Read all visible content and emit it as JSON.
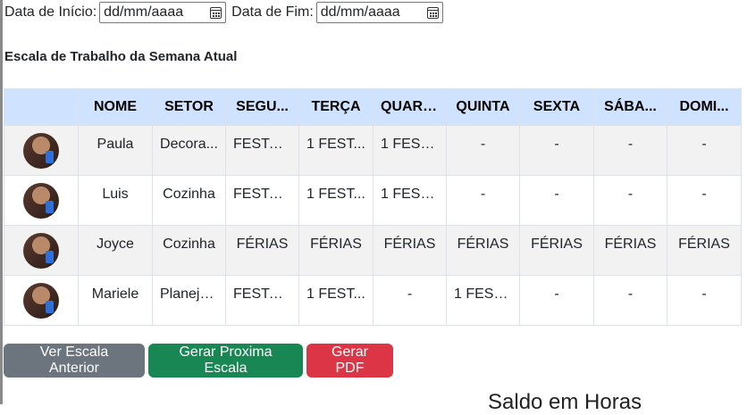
{
  "filters": {
    "start_label": "Data de Início:",
    "start_value": "dd/mm/aaaa",
    "end_label": "Data de Fim:",
    "end_value": "dd/mm/aaaa"
  },
  "title": "Escala de Trabalho da Semana Atual",
  "table": {
    "headers": [
      "",
      "NOME",
      "SETOR",
      "SEGU...",
      "TERÇA",
      "QUARTA",
      "QUINTA",
      "SEXTA",
      "SÁBA...",
      "DOMI..."
    ],
    "rows": [
      {
        "name": "Paula",
        "sector": "Decora...",
        "days": [
          "FESTAS...",
          "1 FEST...",
          "1 FEST...",
          "-",
          "-",
          "-",
          "-"
        ]
      },
      {
        "name": "Luis",
        "sector": "Cozinha",
        "days": [
          "FESTAS...",
          "1 FEST...",
          "1 FEST...",
          "-",
          "-",
          "-",
          "-"
        ]
      },
      {
        "name": "Joyce",
        "sector": "Cozinha",
        "days": [
          "FÉRIAS",
          "FÉRIAS",
          "FÉRIAS",
          "FÉRIAS",
          "FÉRIAS",
          "FÉRIAS",
          "FÉRIAS"
        ]
      },
      {
        "name": "Mariele",
        "sector": "Planeja...",
        "days": [
          "FESTAS...",
          "1 FEST...",
          "-",
          "1 FEST...",
          "-",
          "-",
          "-"
        ]
      }
    ]
  },
  "buttons": {
    "previous": "Ver Escala Anterior",
    "next": "Gerar Proxima Escala",
    "pdf": "Gerar PDF"
  },
  "saldo_heading": "Saldo em Horas",
  "colors": {
    "header_bg": "#cfe2ff",
    "secondary": "#6c757d",
    "success": "#198754",
    "danger": "#dc3545"
  },
  "icons": {
    "date_picker": "calendar-icon",
    "avatar": "employee-photo"
  }
}
